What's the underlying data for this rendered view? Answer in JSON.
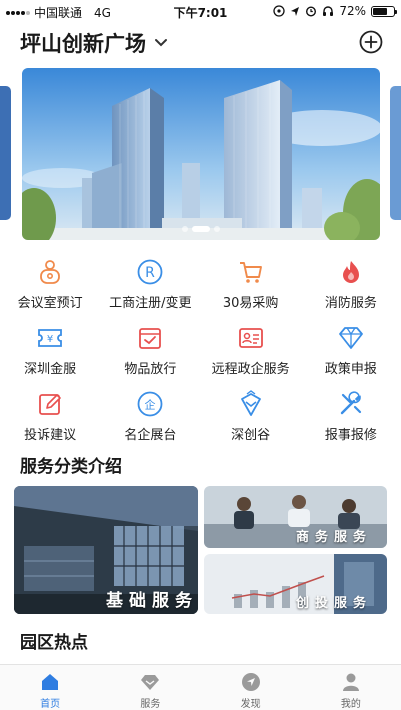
{
  "status_bar": {
    "carrier": "中国联通",
    "network": "4G",
    "time": "下午7:01",
    "battery": "72%",
    "battery_level": 0.72
  },
  "header": {
    "title": "坪山创新广场",
    "dropdown_icon": "chevron-down-icon",
    "add_icon": "plus-circle-icon"
  },
  "banner": {
    "slide_count": 3,
    "active_slide": 2
  },
  "services": [
    {
      "label": "会议室预订",
      "icon": "meeting-room-icon",
      "color": "#f08a4b"
    },
    {
      "label": "工商注册/变更",
      "icon": "registered-icon",
      "color": "#3a8ee6"
    },
    {
      "label": "30易采购",
      "icon": "shopping-cart-icon",
      "color": "#f08a4b"
    },
    {
      "label": "消防服务",
      "icon": "fire-icon",
      "color": "#e8504f"
    },
    {
      "label": "深圳金服",
      "icon": "finance-ticket-icon",
      "color": "#3a8ee6"
    },
    {
      "label": "物品放行",
      "icon": "checklist-icon",
      "color": "#e8504f"
    },
    {
      "label": "远程政企服务",
      "icon": "id-card-icon",
      "color": "#e8504f"
    },
    {
      "label": "政策申报",
      "icon": "diamond-icon",
      "color": "#3a8ee6"
    },
    {
      "label": "投诉建议",
      "icon": "edit-icon",
      "color": "#e8504f"
    },
    {
      "label": "名企展台",
      "icon": "enterprise-icon",
      "color": "#3a8ee6"
    },
    {
      "label": "深创谷",
      "icon": "badge-icon",
      "color": "#3a8ee6"
    },
    {
      "label": "报事报修",
      "icon": "tools-icon",
      "color": "#3a8ee6"
    }
  ],
  "sections": {
    "service_intro": "服务分类介绍",
    "park_hot": "园区热点"
  },
  "categories": {
    "basic": "基础服务",
    "business": "商务服务",
    "investment": "创投服务"
  },
  "tabs": [
    {
      "label": "首页",
      "icon": "home-icon",
      "active": true
    },
    {
      "label": "服务",
      "icon": "service-icon",
      "active": false
    },
    {
      "label": "发现",
      "icon": "compass-icon",
      "active": false
    },
    {
      "label": "我的",
      "icon": "user-icon",
      "active": false
    }
  ],
  "colors": {
    "accent": "#2f7de1",
    "orange": "#f08a4b",
    "red": "#e8504f",
    "blue": "#3a8ee6"
  }
}
